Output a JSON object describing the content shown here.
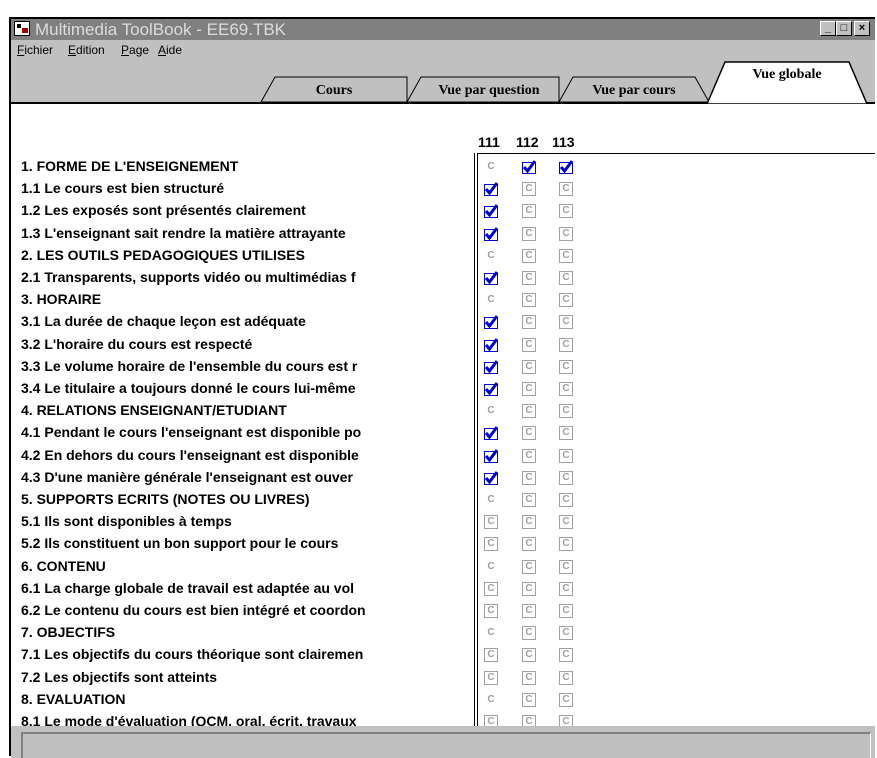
{
  "window": {
    "title": "Multimedia ToolBook - EE69.TBK"
  },
  "title_buttons": {
    "minimize": "_",
    "maximize": "□",
    "close": "×"
  },
  "menu": [
    {
      "label": "Fichier",
      "accel": "F",
      "rest": "ichier"
    },
    {
      "label": "Edition",
      "accel": "E",
      "rest": "dition"
    },
    {
      "label": "Page",
      "accel": "P",
      "rest": "age"
    },
    {
      "label": "Aide",
      "accel": "A",
      "rest": "ide"
    }
  ],
  "tabs": [
    {
      "label": "Cours",
      "active": false
    },
    {
      "label": "Vue par question",
      "active": false
    },
    {
      "label": "Vue par cours",
      "active": false
    },
    {
      "label": "Vue globale",
      "active": true
    }
  ],
  "columns": [
    "111",
    "112",
    "113"
  ],
  "colors": {
    "check": "#0000d0",
    "grey": "#a0a0a0"
  },
  "rows": [
    {
      "label": "1. FORME DE L'ENSEIGNEMENT",
      "section": true,
      "states": [
        "g",
        "x",
        "x"
      ]
    },
    {
      "label": "1.1 Le cours est bien structuré",
      "section": false,
      "states": [
        "x",
        "u",
        "u"
      ]
    },
    {
      "label": "1.2 Les exposés sont présentés clairement",
      "section": false,
      "states": [
        "x",
        "u",
        "u"
      ]
    },
    {
      "label": "1.3 L'enseignant sait rendre la matière attrayante",
      "section": false,
      "states": [
        "x",
        "u",
        "u"
      ]
    },
    {
      "label": "2. LES OUTILS PEDAGOGIQUES UTILISES",
      "section": true,
      "states": [
        "g",
        "u",
        "u"
      ]
    },
    {
      "label": "2.1 Transparents, supports vidéo ou multimédias f",
      "section": false,
      "states": [
        "x",
        "u",
        "u"
      ]
    },
    {
      "label": "3. HORAIRE",
      "section": true,
      "states": [
        "g",
        "u",
        "u"
      ]
    },
    {
      "label": "3.1 La durée de chaque leçon est adéquate",
      "section": false,
      "states": [
        "x",
        "u",
        "u"
      ]
    },
    {
      "label": "3.2 L'horaire du cours est respecté",
      "section": false,
      "states": [
        "x",
        "u",
        "u"
      ]
    },
    {
      "label": "3.3 Le volume horaire de l'ensemble du cours est r",
      "section": false,
      "states": [
        "x",
        "u",
        "u"
      ]
    },
    {
      "label": "3.4 Le titulaire a toujours donné le cours lui-même",
      "section": false,
      "states": [
        "x",
        "u",
        "u"
      ]
    },
    {
      "label": "4. RELATIONS ENSEIGNANT/ETUDIANT",
      "section": true,
      "states": [
        "g",
        "u",
        "u"
      ]
    },
    {
      "label": "4.1 Pendant le cours l'enseignant est disponible po",
      "section": false,
      "states": [
        "x",
        "u",
        "u"
      ]
    },
    {
      "label": "4.2 En dehors du cours l'enseignant est disponible",
      "section": false,
      "states": [
        "x",
        "u",
        "u"
      ]
    },
    {
      "label": "4.3 D'une manière générale l'enseignant est ouver",
      "section": false,
      "states": [
        "x",
        "u",
        "u"
      ]
    },
    {
      "label": "5. SUPPORTS ECRITS (NOTES OU LIVRES)",
      "section": true,
      "states": [
        "g",
        "u",
        "u"
      ]
    },
    {
      "label": "5.1 Ils sont disponibles à temps",
      "section": false,
      "states": [
        "u",
        "u",
        "u"
      ]
    },
    {
      "label": "5.2 Ils constituent un bon support pour le cours",
      "section": false,
      "states": [
        "u",
        "u",
        "u"
      ]
    },
    {
      "label": "6. CONTENU",
      "section": true,
      "states": [
        "g",
        "u",
        "u"
      ]
    },
    {
      "label": "6.1 La charge globale de travail est adaptée au vol",
      "section": false,
      "states": [
        "u",
        "u",
        "u"
      ]
    },
    {
      "label": "6.2 Le contenu du cours est bien intégré et coordon",
      "section": false,
      "states": [
        "u",
        "u",
        "u"
      ]
    },
    {
      "label": "7. OBJECTIFS",
      "section": true,
      "states": [
        "g",
        "u",
        "u"
      ]
    },
    {
      "label": "7.1 Les objectifs du cours théorique sont clairemen",
      "section": false,
      "states": [
        "u",
        "u",
        "u"
      ]
    },
    {
      "label": "7.2 Les objectifs sont atteints",
      "section": false,
      "states": [
        "u",
        "u",
        "u"
      ]
    },
    {
      "label": "8. EVALUATION",
      "section": true,
      "states": [
        "g",
        "u",
        "u"
      ]
    },
    {
      "label": "8.1 Le mode d'évaluation (QCM, oral, écrit, travaux",
      "section": false,
      "states": [
        "u",
        "u",
        "u"
      ]
    }
  ],
  "checkbox_glyph": "C",
  "status": {
    "text": ""
  }
}
